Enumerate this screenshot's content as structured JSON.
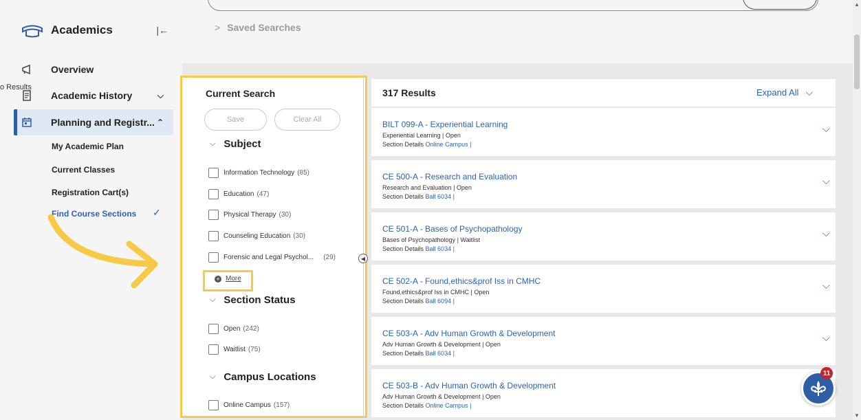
{
  "sidebar": {
    "title": "Academics",
    "collapse_icon": "collapse-left-icon",
    "back_fragment": "o Results",
    "items": [
      {
        "label": "Overview",
        "icon": "megaphone-icon"
      },
      {
        "label": "Academic History",
        "icon": "document-icon"
      },
      {
        "label": "Planning and Registr...",
        "icon": "calendar-icon"
      }
    ],
    "sub_items": [
      {
        "label": "My Academic Plan"
      },
      {
        "label": "Current Classes"
      },
      {
        "label": "Registration Cart(s)"
      },
      {
        "label": "Find Course Sections"
      }
    ]
  },
  "top": {
    "saved_searches": "Saved Searches"
  },
  "filters": {
    "title": "Current Search",
    "save_label": "Save",
    "clear_label": "Clear All",
    "more_label": "More",
    "sections": [
      {
        "title": "Subject",
        "options": [
          {
            "label": "Information Technology",
            "count": "(85)"
          },
          {
            "label": "Education",
            "count": "(47)"
          },
          {
            "label": "Physical Therapy",
            "count": "(30)"
          },
          {
            "label": "Counseling Education",
            "count": "(30)"
          },
          {
            "label": "Forensic and Legal Psychol...",
            "count": "(29)"
          }
        ]
      },
      {
        "title": "Section Status",
        "options": [
          {
            "label": "Open",
            "count": "(242)"
          },
          {
            "label": "Waitlist",
            "count": "(75)"
          }
        ]
      },
      {
        "title": "Campus Locations",
        "options": [
          {
            "label": "Online Campus",
            "count": "(157)"
          }
        ]
      }
    ]
  },
  "results": {
    "count_label": "317 Results",
    "expand_all": "Expand All",
    "items": [
      {
        "title": "BILT 099-A - Experiential Learning",
        "subtitle": "Experiential Learning  |  Open",
        "details_label": "Section Details",
        "location": "Online Campus |"
      },
      {
        "title": "CE 500-A - Research and Evaluation",
        "subtitle": "Research and Evaluation  |  Open",
        "details_label": "Section Details",
        "location": "Ball 6034 |"
      },
      {
        "title": "CE 501-A - Bases of Psychopathology",
        "subtitle": "Bases of Psychopathology  |  Waitlist",
        "details_label": "Section Details",
        "location": "Ball 6034 |"
      },
      {
        "title": "CE 502-A - Found,ethics&prof Iss in CMHC",
        "subtitle": "Found,ethics&prof Iss in CMHC  |  Open",
        "details_label": "Section Details",
        "location": "Ball 6094 |"
      },
      {
        "title": "CE 503-A - Adv Human Growth & Development",
        "subtitle": "Adv Human Growth & Development  |  Open",
        "details_label": "Section Details",
        "location": "Ball 6034 |"
      },
      {
        "title": "CE 503-B - Adv Human Growth & Development",
        "subtitle": "Adv Human Growth & Development  |  Open",
        "details_label": "Section Details",
        "location": "Online Campus |"
      }
    ]
  },
  "chat": {
    "badge": "11",
    "icon": "fleur-de-lis-icon"
  },
  "colors": {
    "accent": "#2a63b7",
    "highlight": "#f7c948",
    "badge": "#c0262d"
  }
}
